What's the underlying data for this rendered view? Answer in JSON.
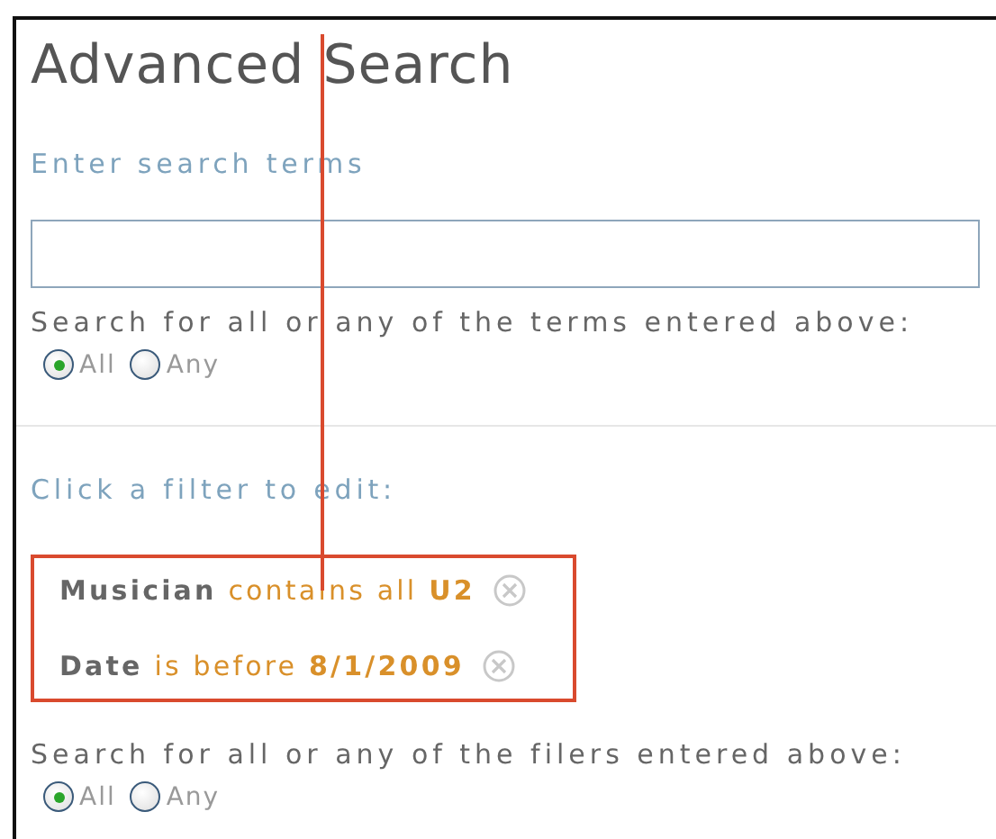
{
  "title": "Advanced Search",
  "terms_label": "Enter search terms",
  "terms_match": {
    "label": "Search for all or any of the terms entered above:",
    "options": [
      {
        "label": "All",
        "selected": true
      },
      {
        "label": "Any",
        "selected": false
      }
    ]
  },
  "filters_label": "Click a filter to edit:",
  "filters_highlighted": true,
  "filters": [
    {
      "field": "Musician",
      "operator": "contains all",
      "value": "U2"
    },
    {
      "field": "Date",
      "operator": "is before",
      "value": "8/1/2009"
    }
  ],
  "filters_match": {
    "label": "Search for all or any of the filers entered above:",
    "options": [
      {
        "label": "All",
        "selected": true
      },
      {
        "label": "Any",
        "selected": false
      }
    ]
  }
}
